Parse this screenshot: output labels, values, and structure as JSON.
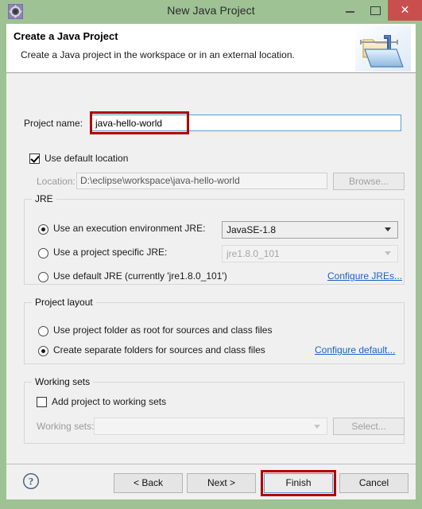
{
  "window": {
    "title": "New Java Project",
    "app_icon": "gear-icon",
    "minimize_label": "Minimize",
    "maximize_label": "Maximize",
    "close_label": "✕",
    "titlebar_color": "#9ec294",
    "close_button_color": "#c94f4f"
  },
  "header": {
    "title": "Create a Java Project",
    "description": "Create a Java project in the workspace or in an external location.",
    "icon": "java-project-folder-icon"
  },
  "form": {
    "project_name_label": "Project name:",
    "project_name_value": "java-hello-world",
    "project_name_placeholder": "",
    "use_default_location_label": "Use default location",
    "use_default_location_checked": true,
    "location_label": "Location:",
    "location_value": "D:\\eclipse\\workspace\\java-hello-world",
    "browse_label": "Browse..."
  },
  "jre": {
    "group_title": "JRE",
    "options": [
      {
        "label": "Use an execution environment JRE:",
        "selected": true
      },
      {
        "label": "Use a project specific JRE:",
        "selected": false
      },
      {
        "label": "Use default JRE (currently 'jre1.8.0_101')",
        "selected": false
      }
    ],
    "execution_environment_value": "JavaSE-1.8",
    "project_specific_value": "jre1.8.0_101",
    "configure_link": "Configure JREs..."
  },
  "project_layout": {
    "group_title": "Project layout",
    "options": [
      {
        "label": "Use project folder as root for sources and class files",
        "selected": false
      },
      {
        "label": "Create separate folders for sources and class files",
        "selected": true
      }
    ],
    "configure_link": "Configure default..."
  },
  "working_sets": {
    "group_title": "Working sets",
    "add_label": "Add project to working sets",
    "add_checked": false,
    "working_sets_label": "Working sets:",
    "working_sets_value": "",
    "select_label": "Select..."
  },
  "footer": {
    "help_icon": "help-question-icon",
    "back_label": "< Back",
    "next_label": "Next >",
    "finish_label": "Finish",
    "cancel_label": "Cancel"
  },
  "annotations": {
    "highlight_color": "#b00000",
    "focus_border_color": "#5c9ccc"
  }
}
